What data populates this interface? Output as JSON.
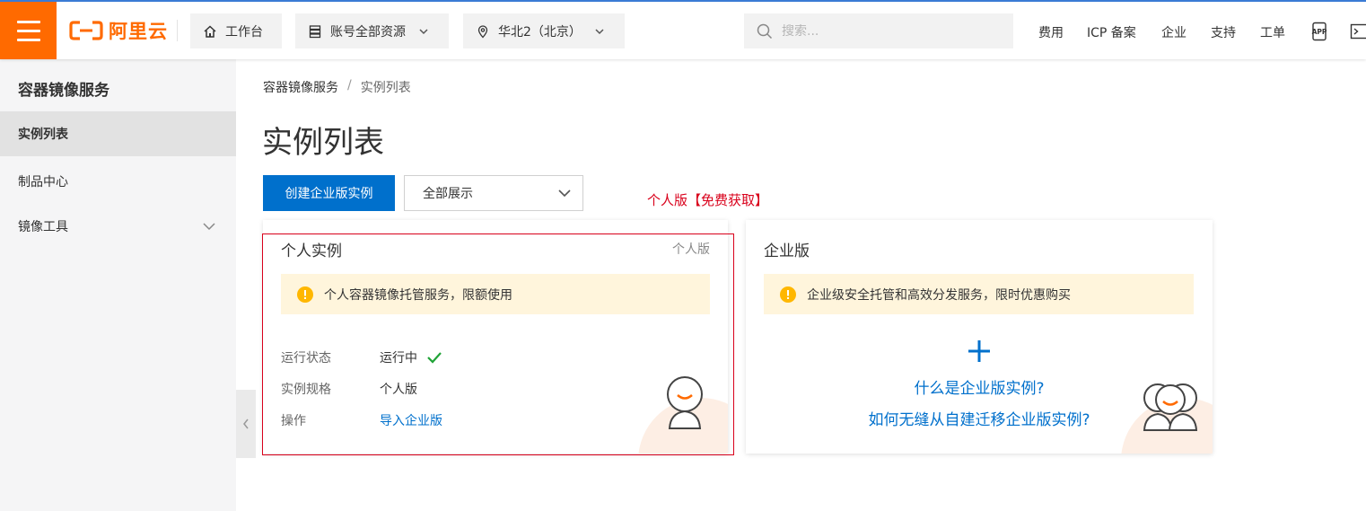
{
  "topbar": {
    "logo_text": "阿里云",
    "workbench": "工作台",
    "resources": "账号全部资源",
    "region": "华北2（北京）",
    "search_placeholder": "搜索...",
    "links": [
      "费用",
      "ICP 备案",
      "企业",
      "支持",
      "工单"
    ],
    "brand_color": "#ff6a00",
    "icons": [
      "menu-icon",
      "home-icon",
      "resource-stack-icon",
      "location-pin-icon",
      "search-icon",
      "app-icon",
      "terminal-icon"
    ]
  },
  "sidebar": {
    "title": "容器镜像服务",
    "items": [
      {
        "label": "实例列表",
        "active": true
      },
      {
        "label": "制品中心",
        "active": false
      },
      {
        "label": "镜像工具",
        "active": false,
        "expandable": true
      }
    ]
  },
  "main": {
    "breadcrumb": [
      "容器镜像服务",
      "/",
      "实例列表"
    ],
    "title": "实例列表",
    "create_button": "创建企业版实例",
    "filter_select": "全部展示",
    "annotation": "个人版【免费获取】",
    "accent_color": "#0070cc",
    "annotation_color": "#d9001b"
  },
  "personal_card": {
    "title": "个人实例",
    "tag": "个人版",
    "alert": "个人容器镜像托管服务，限额使用",
    "rows": [
      {
        "key": "运行状态",
        "value": "运行中",
        "status_icon": "check-icon"
      },
      {
        "key": "实例规格",
        "value": "个人版"
      },
      {
        "key": "操作",
        "value": "导入企业版"
      }
    ]
  },
  "enterprise_card": {
    "title": "企业版",
    "alert": "企业级安全托管和高效分发服务，限时优惠购买",
    "link1": "什么是企业版实例?",
    "link2": "如何无缝从自建迁移企业版实例?"
  }
}
